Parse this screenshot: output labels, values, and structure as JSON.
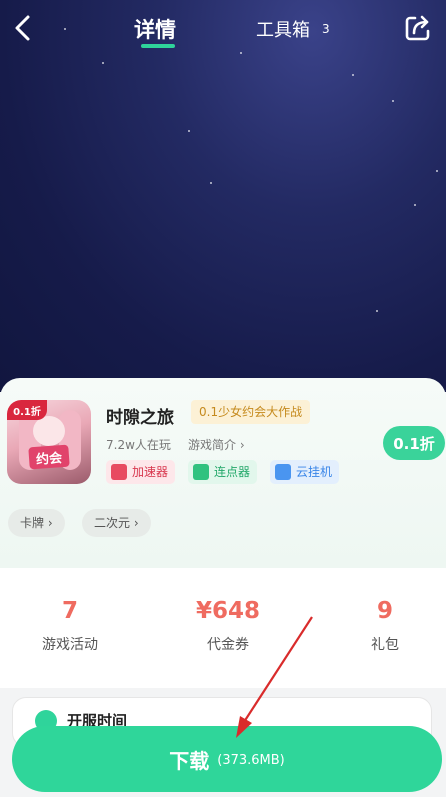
{
  "header": {
    "tab_detail": "详情",
    "tab_tools": "工具箱",
    "tab_tools_count": "3",
    "icons": {
      "back": "back-arrow-icon",
      "share": "share-icon"
    }
  },
  "game": {
    "name": "时隙之旅",
    "slogan": "0.1少女约会大作战",
    "players": "7.2w人在玩",
    "intro_link": "游戏简介",
    "icon_badge": "0.1折",
    "icon_sign": "约会",
    "discount": "0.1折",
    "features": [
      {
        "label": "加速器",
        "icon": "rocket-icon"
      },
      {
        "label": "连点器",
        "icon": "tap-icon"
      },
      {
        "label": "云挂机",
        "icon": "cloud-icon"
      }
    ],
    "tags": [
      "卡牌",
      "二次元"
    ]
  },
  "stats": [
    {
      "value": "7",
      "label": "游戏活动"
    },
    {
      "value": "¥648",
      "label": "代金券"
    },
    {
      "value": "9",
      "label": "礼包"
    }
  ],
  "open_time": {
    "text": "开服时间"
  },
  "download": {
    "label": "下载",
    "size": "(373.6MB)"
  },
  "colors": {
    "accent": "#2fd69a",
    "stat_value": "#ef6b60",
    "hero_bg": "#161b4a",
    "annotation_arrow": "#d92b2b"
  }
}
